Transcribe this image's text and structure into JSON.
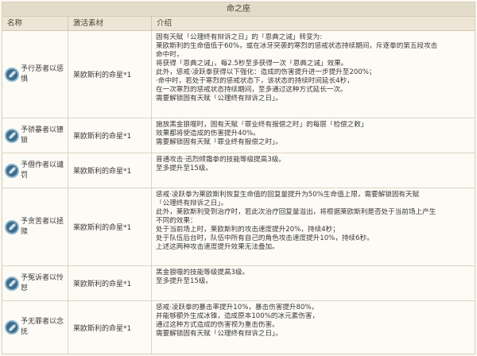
{
  "table": {
    "title": "命之座",
    "headers": [
      "名称",
      "激活素材",
      "介绍"
    ],
    "rows": [
      {
        "name": "予行恶者以惩惧",
        "name_lines": [
          "予行恶者以惩",
          "惧"
        ],
        "material": "莱欧斯利的命星*1",
        "desc": [
          "固有天赋「公理终有辩诉之日」的「恩典之诫」转变为:",
          "莱欧斯利的生命值低于60%，或在冰牙突袭的寒烈的惩戒状态持续期间，斥逐拳的第五段攻击",
          "命中时，",
          "将获得「恩典之诫」，每2.5秒至多获得一次「恩典之诫」效果。",
          "此外，惩戒·凌跃拳获得以下强化：造成的伤害提升进一步提升至200%；",
          "·命中时，若处于寒烈的惩戒状态下，该状态的持续时间延长4秒，",
          "在一次寒烈的惩戒状态持续期间，至多通过这种方式延长一次。",
          "需要解锁固有天赋「公理终有辩诉之日」。"
        ]
      },
      {
        "name": "予骄暴者以镣锁",
        "name_lines": [
          "予骄暴者以镣",
          "锁"
        ],
        "material": "莱欧斯利的命星*1",
        "desc": [
          "施放黑金狼噬时，固有天赋「罪业终有报偿之时」的每层「检偿之敕」",
          "效果都将使造成的伤害提升40%。",
          "需要解锁固有天赋「罪业终有报偿之时」。"
        ]
      },
      {
        "name": "予僭作者以谴罚",
        "name_lines": [
          "予僭作者以谴",
          "罚"
        ],
        "material": "莱欧斯利的命星*1",
        "desc": [
          "普通攻击·迅烈倾霜拳的技能等级提高3级。",
          "至多提升至15级。"
        ]
      },
      {
        "name": "予贪苦者以拯赎",
        "name_lines": [
          "予贪苦者以拯",
          "赎"
        ],
        "material": "莱欧斯利的命星*1",
        "desc": [
          "惩戒·凌跃拳为莱欧斯利恢复生命值的回复量提升为50%生命值上限，需要解锁固有天赋",
          "「公理终有辩诉之日」。",
          "此外，莱欧斯利受到治疗时，若此次治疗回复量溢出，将根据莱欧斯利是否处于当前场上产生",
          "不同的效果：",
          "处于当前场上时，莱欧斯利的攻击速度提升20%，持续4秒；",
          "处于队伍后台时，队伍中所有自己的角色攻击速度提升10%，持续6秒。",
          "上述这两种攻击速度提升效果无法叠加。"
        ]
      },
      {
        "name": "予冤诉者以怜恕",
        "name_lines": [
          "予冤诉者以怜",
          "恕"
        ],
        "material": "莱欧斯利的命星*1",
        "desc": [
          "黑金狼噬的技能等级提高3级。",
          "至多提升至15级。"
        ]
      },
      {
        "name": "予无罪者以念抚",
        "name_lines": [
          "予无罪者以念",
          "抚"
        ],
        "material": "莱欧斯利的命星*1",
        "desc": [
          "惩戒·凌跃拳的暴击率提升10%，暴击伤害提升80%，",
          "并能够额外生成冰锥，造成原本100%的冰元素伤害，",
          "通过这种方式造成的伤害视为重击伤害。",
          "需要解锁固有天赋「公理终有辩诉之日」。"
        ]
      }
    ]
  },
  "colors": {
    "title_bg": "#e4dccb",
    "header_bg": "#ede6d6",
    "icon_bg": "#3d6d8b",
    "icon_ring": "#8fb8cf"
  },
  "icon": "hydro-constellation-icon"
}
